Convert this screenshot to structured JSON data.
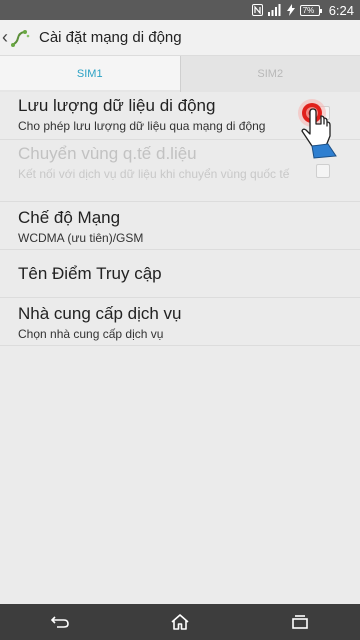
{
  "status_bar": {
    "time": "6:24",
    "battery": "7%",
    "icons": [
      "nfc-icon",
      "signal-icon",
      "charging-icon"
    ]
  },
  "action_bar": {
    "title": "Cài đặt mạng di động",
    "icon": "network-settings-icon"
  },
  "tabs": [
    {
      "label": "SIM1",
      "active": true
    },
    {
      "label": "SIM2",
      "active": false
    }
  ],
  "settings": {
    "items": [
      {
        "title": "Lưu lượng dữ liệu di động",
        "summary": "Cho phép lưu lượng dữ liệu qua mạng di động",
        "enabled": true,
        "checkbox": true
      },
      {
        "title": "Chuyển vùng q.tế d.liệu",
        "summary": "Kết nối với dịch vụ dữ liệu khi chuyển vùng quốc tế",
        "enabled": false,
        "checkbox": true
      },
      {
        "title": "Chế độ Mạng",
        "summary": "WCDMA (ưu tiên)/GSM",
        "enabled": true
      },
      {
        "title": "Tên Điểm Truy cập",
        "summary": "",
        "enabled": true
      },
      {
        "title": "Nhà cung cấp dịch vụ",
        "summary": "Chọn nhà cung cấp dịch vụ",
        "enabled": true
      }
    ]
  },
  "nav_bar": {
    "buttons": [
      "back-icon",
      "home-icon",
      "recents-icon"
    ]
  },
  "colors": {
    "accent": "#2aa1c4",
    "status_bar": "#5a5a5a",
    "nav_bar": "#3d3d3d",
    "tap_indicator": "#e0201b"
  }
}
